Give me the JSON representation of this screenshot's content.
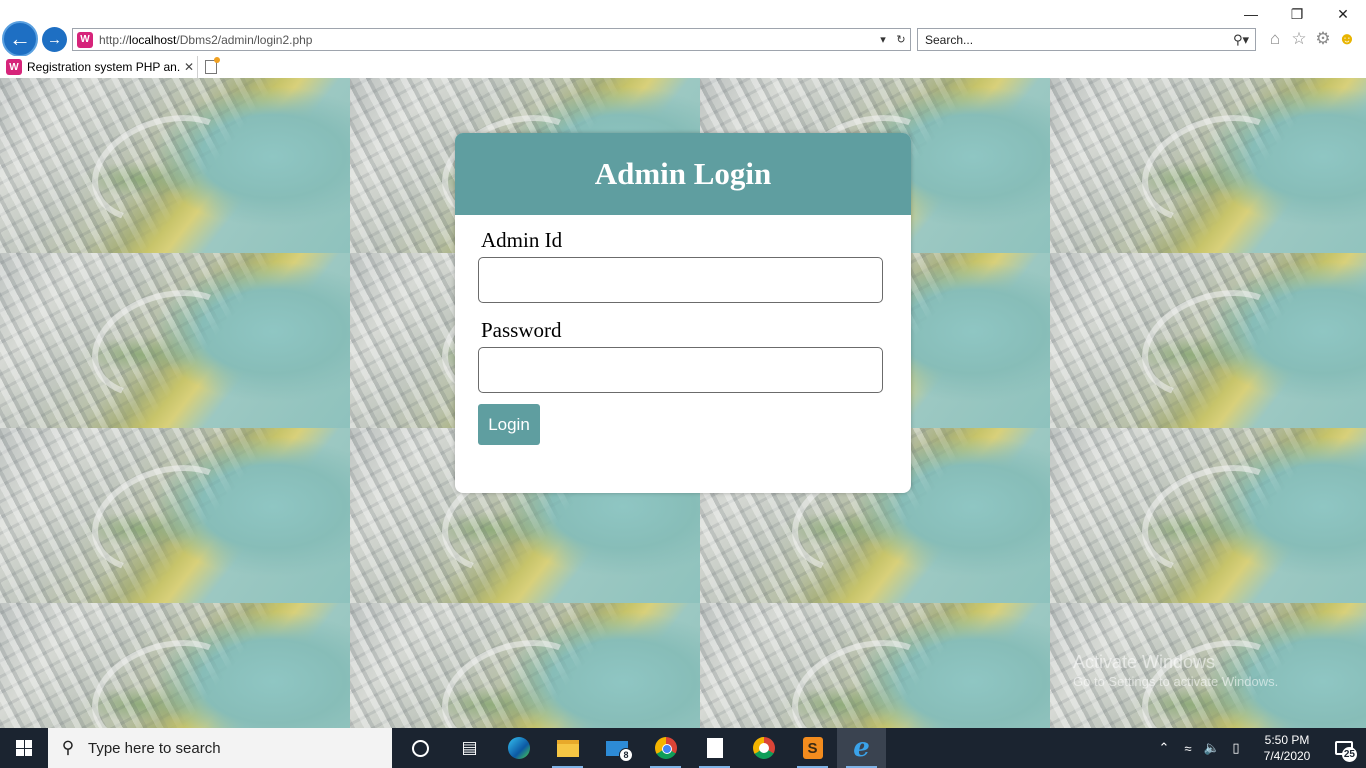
{
  "browser": {
    "url_prefix": "http://",
    "url_host": "localhost",
    "url_path": "/Dbms2/admin/login2.php",
    "search_placeholder": "Search...",
    "tab_title": "Registration system PHP an...",
    "site_icon_glyph": "W"
  },
  "login": {
    "title": "Admin Login",
    "admin_id_label": "Admin Id",
    "admin_id_value": "",
    "password_label": "Password",
    "password_value": "",
    "button_label": "Login",
    "accent_color": "#5f9ea0"
  },
  "watermark": {
    "title": "Activate Windows",
    "subtitle": "Go to Settings to activate Windows."
  },
  "taskbar": {
    "search_placeholder": "Type here to search",
    "mail_badge": "8",
    "time": "5:50 PM",
    "date": "7/4/2020",
    "notification_count": "25"
  }
}
